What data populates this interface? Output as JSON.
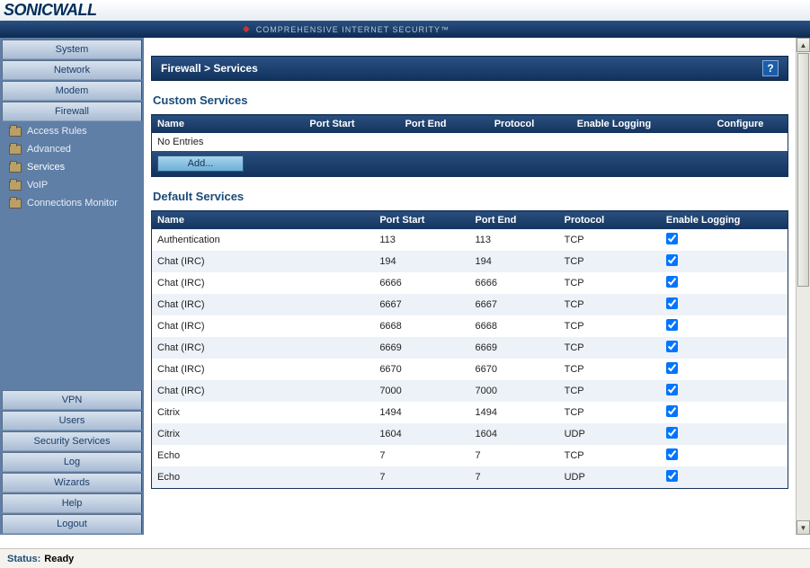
{
  "brand": {
    "logo": "SONICWALL",
    "tagline": "COMPREHENSIVE INTERNET SECURITY™"
  },
  "sidebar": {
    "topButtons": [
      {
        "label": "System"
      },
      {
        "label": "Network"
      },
      {
        "label": "Modem"
      },
      {
        "label": "Firewall"
      }
    ],
    "subItems": [
      {
        "label": "Access Rules"
      },
      {
        "label": "Advanced"
      },
      {
        "label": "Services"
      },
      {
        "label": "VoIP"
      },
      {
        "label": "Connections Monitor"
      }
    ],
    "bottomButtons": [
      {
        "label": "VPN"
      },
      {
        "label": "Users"
      },
      {
        "label": "Security Services"
      },
      {
        "label": "Log"
      },
      {
        "label": "Wizards"
      },
      {
        "label": "Help"
      },
      {
        "label": "Logout"
      }
    ]
  },
  "breadcrumb": "Firewall > Services",
  "help_label": "?",
  "custom": {
    "title": "Custom Services",
    "columns": [
      "Name",
      "Port Start",
      "Port End",
      "Protocol",
      "Enable Logging",
      "Configure"
    ],
    "empty": "No Entries",
    "add_label": "Add..."
  },
  "defaults": {
    "title": "Default Services",
    "columns": [
      "Name",
      "Port Start",
      "Port End",
      "Protocol",
      "Enable Logging"
    ],
    "rows": [
      {
        "name": "Authentication",
        "ps": "113",
        "pe": "113",
        "proto": "TCP",
        "log": true
      },
      {
        "name": "Chat (IRC)",
        "ps": "194",
        "pe": "194",
        "proto": "TCP",
        "log": true
      },
      {
        "name": "Chat (IRC)",
        "ps": "6666",
        "pe": "6666",
        "proto": "TCP",
        "log": true
      },
      {
        "name": "Chat (IRC)",
        "ps": "6667",
        "pe": "6667",
        "proto": "TCP",
        "log": true
      },
      {
        "name": "Chat (IRC)",
        "ps": "6668",
        "pe": "6668",
        "proto": "TCP",
        "log": true
      },
      {
        "name": "Chat (IRC)",
        "ps": "6669",
        "pe": "6669",
        "proto": "TCP",
        "log": true
      },
      {
        "name": "Chat (IRC)",
        "ps": "6670",
        "pe": "6670",
        "proto": "TCP",
        "log": true
      },
      {
        "name": "Chat (IRC)",
        "ps": "7000",
        "pe": "7000",
        "proto": "TCP",
        "log": true
      },
      {
        "name": "Citrix",
        "ps": "1494",
        "pe": "1494",
        "proto": "TCP",
        "log": true
      },
      {
        "name": "Citrix",
        "ps": "1604",
        "pe": "1604",
        "proto": "UDP",
        "log": true
      },
      {
        "name": "Echo",
        "ps": "7",
        "pe": "7",
        "proto": "TCP",
        "log": true
      },
      {
        "name": "Echo",
        "ps": "7",
        "pe": "7",
        "proto": "UDP",
        "log": true
      }
    ]
  },
  "status": {
    "label": "Status:",
    "value": "Ready"
  }
}
